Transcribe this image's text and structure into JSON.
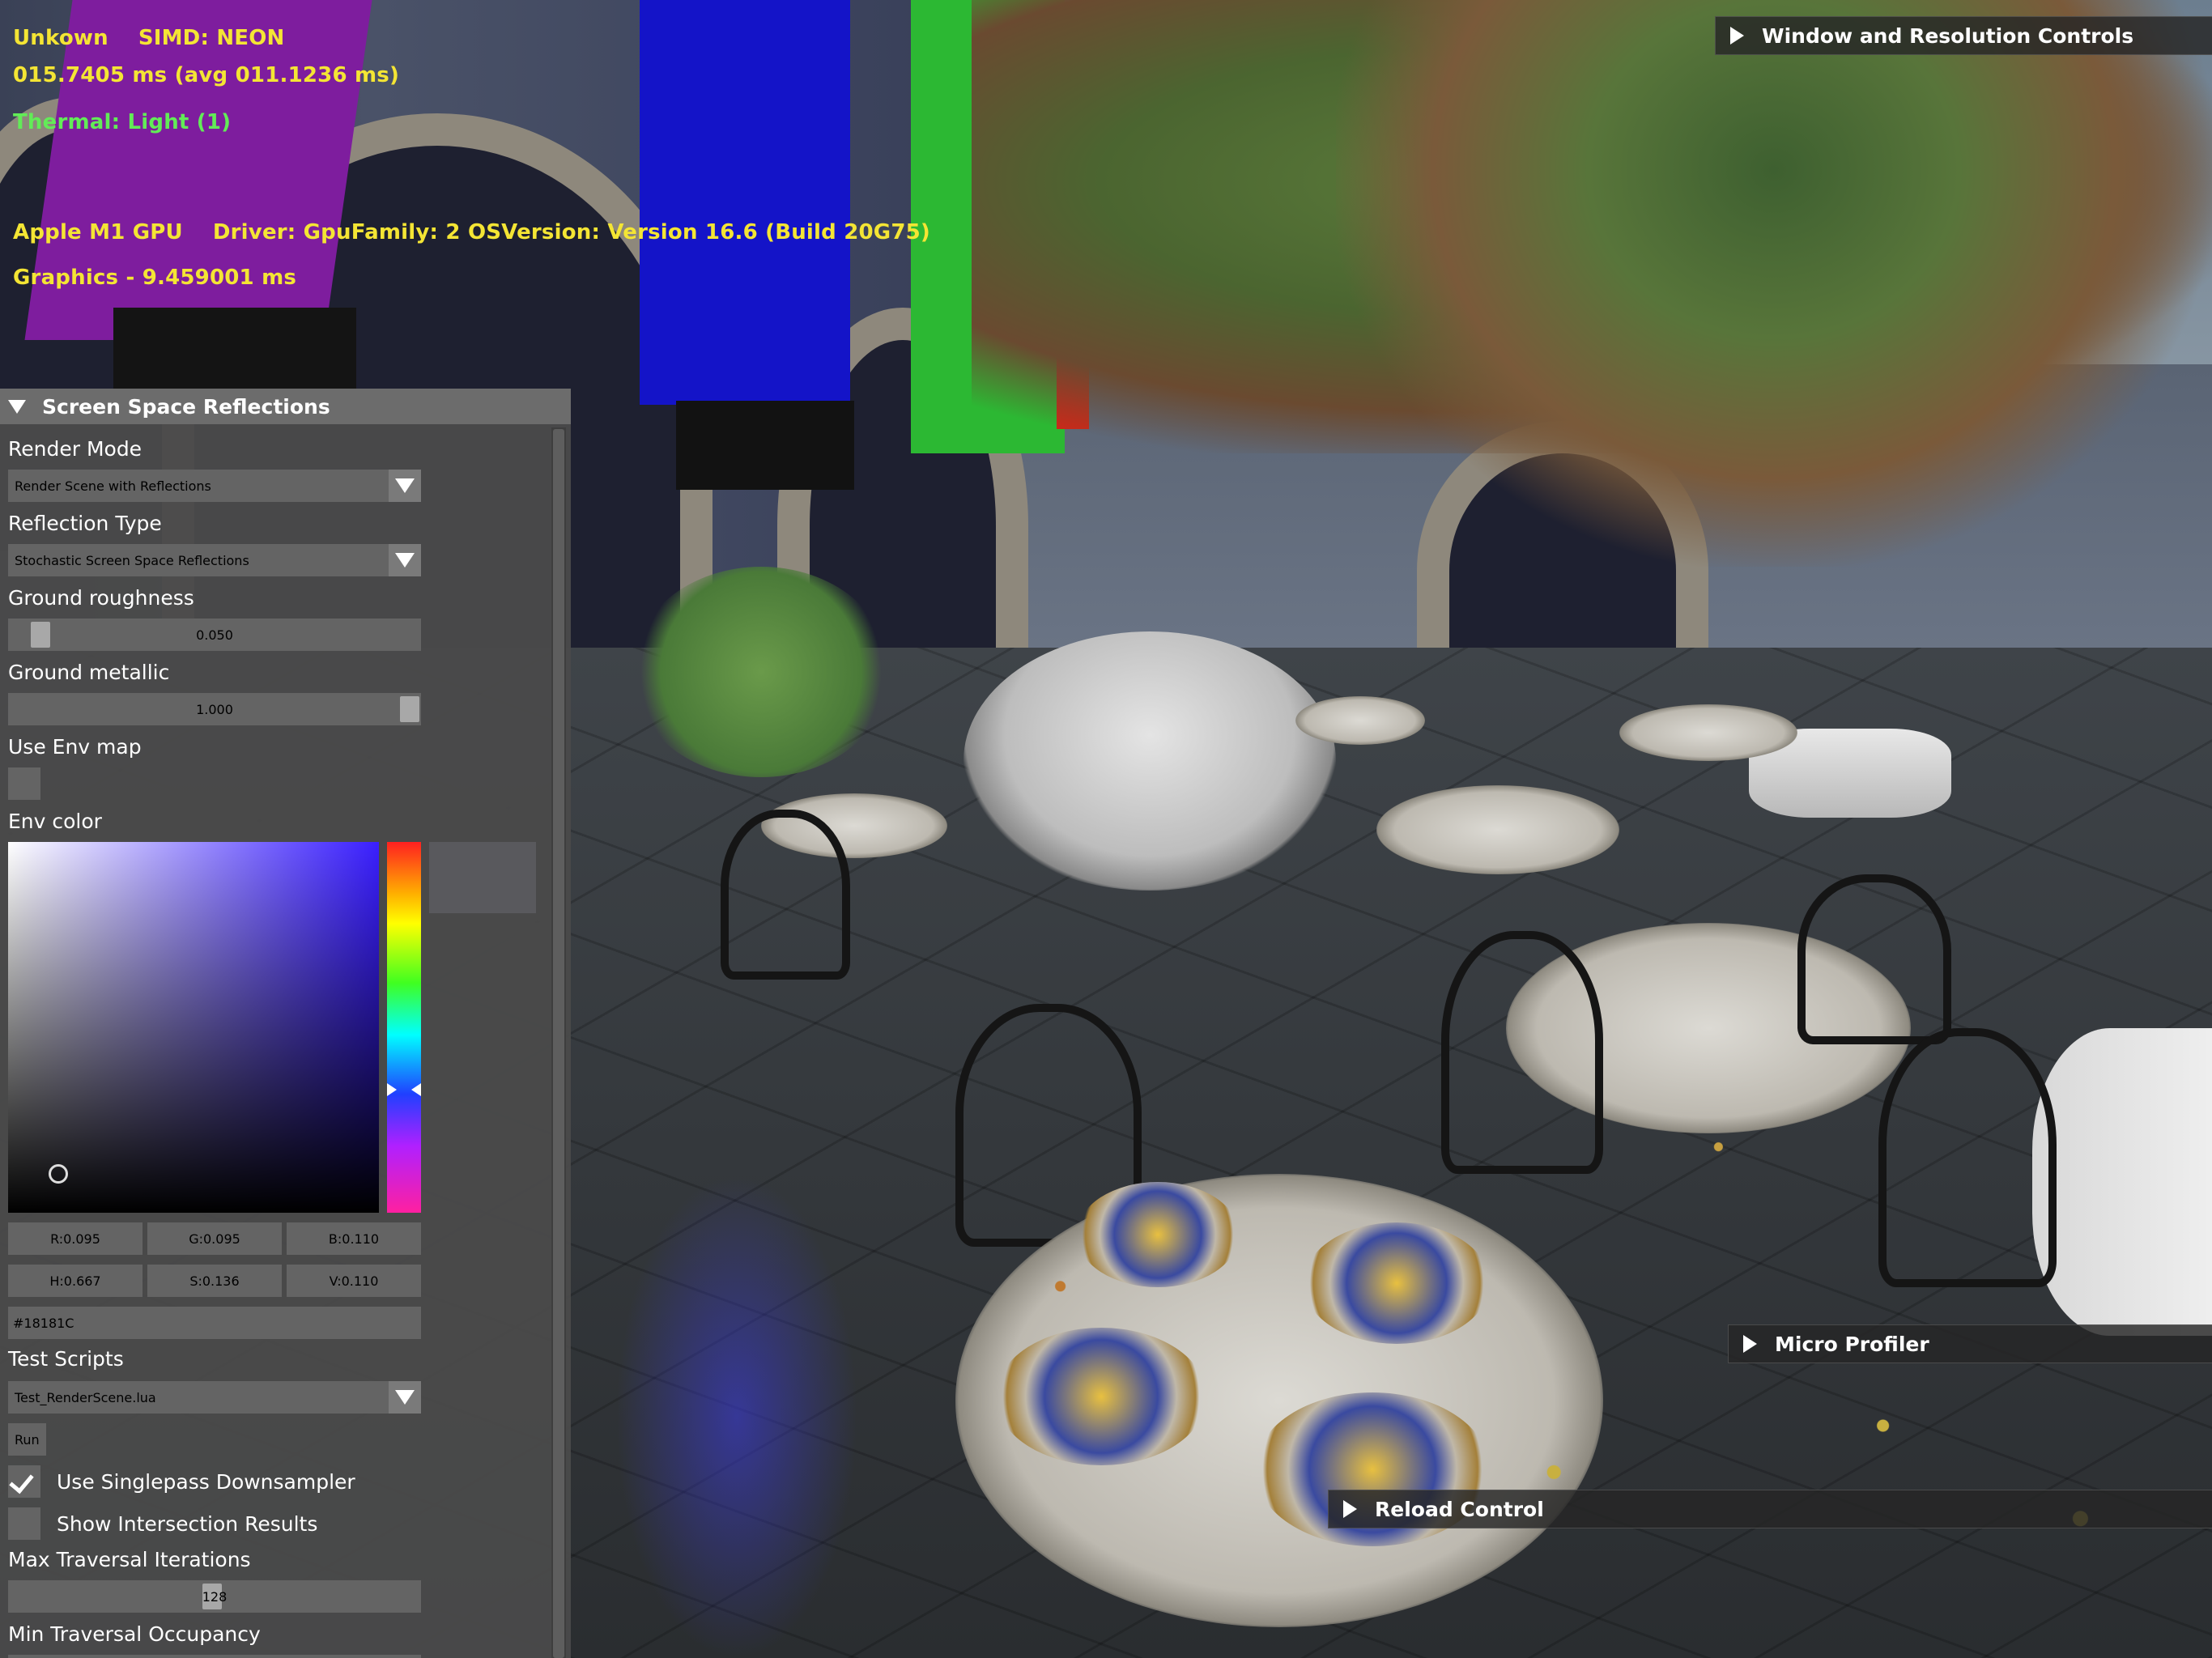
{
  "hud": {
    "cpu_line": "Unkown    SIMD: NEON",
    "frame_time": "015.7405 ms (avg 011.1236 ms)",
    "thermal": "Thermal: Light (1)",
    "gpu_line": "Apple M1 GPU    Driver: GpuFamily: 2 OSVersion: Version 16.6 (Build 20G75)",
    "graphics_time": "Graphics - 9.459001 ms"
  },
  "windows": {
    "window_resolution": "Window and Resolution Controls",
    "micro_profiler": "Micro Profiler",
    "reload_control": "Reload Control"
  },
  "panel": {
    "title": "Screen Space Reflections",
    "render_mode_label": "Render Mode",
    "render_mode_value": "Render Scene with Reflections",
    "reflection_type_label": "Reflection Type",
    "reflection_type_value": "Stochastic Screen Space Reflections",
    "ground_roughness_label": "Ground roughness",
    "ground_roughness_value": "0.050",
    "ground_metallic_label": "Ground metallic",
    "ground_metallic_value": "1.000",
    "use_env_map_label": "Use Env map",
    "use_env_map_checked": false,
    "env_color_label": "Env color",
    "env_color": {
      "r": "R:0.095",
      "g": "G:0.095",
      "b": "B:0.110",
      "h": "H:0.667",
      "s": "S:0.136",
      "v": "V:0.110",
      "hex": "#18181C"
    },
    "test_scripts_label": "Test Scripts",
    "test_scripts_value": "Test_RenderScene.lua",
    "run_label": "Run",
    "singlepass_label": "Use Singlepass Downsampler",
    "singlepass_checked": true,
    "show_intersection_label": "Show Intersection Results",
    "show_intersection_checked": false,
    "max_traversal_label": "Max Traversal Iterations",
    "max_traversal_value": "128",
    "min_traversal_label": "Min Traversal Occupancy"
  },
  "colors": {
    "hud_yellow": "#f4e534",
    "hud_green": "#62ec57",
    "panel_bg": "#4a4a4a",
    "widget_bg": "#646464",
    "env_color_preview": "#18181C"
  },
  "icons": [
    "triangle-right-icon",
    "triangle-down-icon",
    "dropdown-arrow-icon",
    "checkmark-icon"
  ]
}
